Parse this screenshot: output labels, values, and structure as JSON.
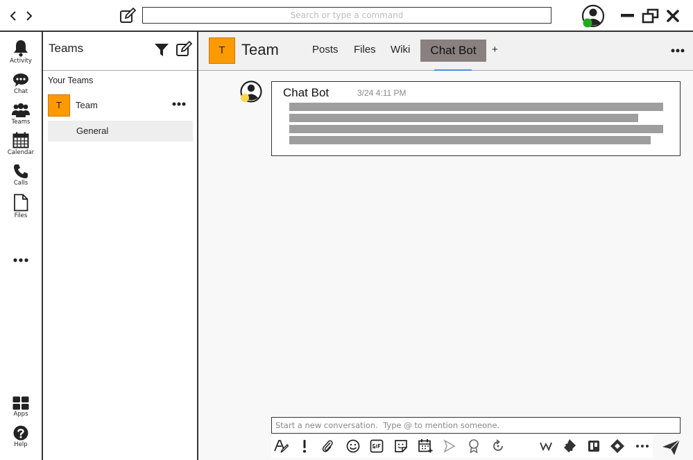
{
  "search": {
    "placeholder": "Search or type a command"
  },
  "rail": {
    "items": [
      {
        "label": "Activity",
        "icon": "bell-icon"
      },
      {
        "label": "Chat",
        "icon": "chat-icon"
      },
      {
        "label": "Teams",
        "icon": "teams-icon"
      },
      {
        "label": "Calendar",
        "icon": "calendar-icon"
      },
      {
        "label": "Calls",
        "icon": "phone-icon"
      },
      {
        "label": "Files",
        "icon": "file-icon"
      }
    ],
    "more_icon": "more-horizontal-icon",
    "bottom": [
      {
        "label": "Apps",
        "icon": "apps-grid-icon"
      },
      {
        "label": "Help",
        "icon": "help-icon"
      }
    ]
  },
  "teams_pane": {
    "title": "Teams",
    "section": "Your Teams",
    "team": {
      "initial": "T",
      "name": "Team"
    },
    "channel": "General"
  },
  "main": {
    "tile_initial": "T",
    "title": "Team",
    "tabs": [
      "Posts",
      "Files",
      "Wiki"
    ],
    "active_tab": "Chat Bot",
    "add_tab": "+"
  },
  "post": {
    "author": "Chat Bot",
    "time": "3/24 4:11 PM"
  },
  "composer": {
    "placeholder": "Start a new conversation.  Type @ to mention someone."
  },
  "colors": {
    "team_tile": "#ff9900",
    "active_tab_bg": "#8a8080",
    "presence_online": "#22aa22",
    "presence_away": "#ffd84d",
    "tab_underline": "#4a90e2",
    "message_placeholder_bar": "#9e9e9e"
  }
}
